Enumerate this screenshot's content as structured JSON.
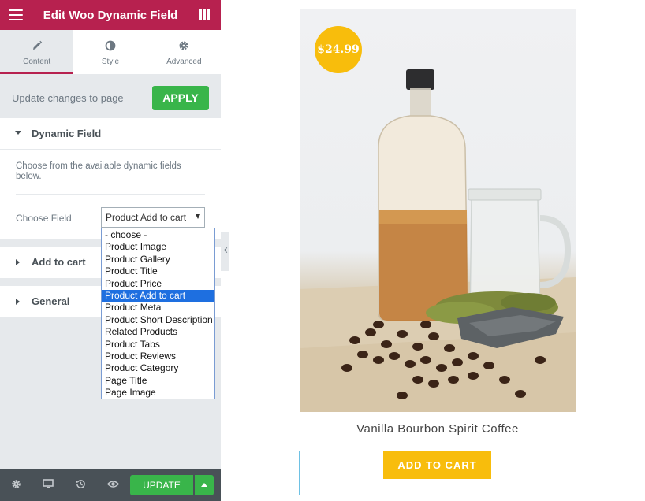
{
  "panel": {
    "title": "Edit Woo Dynamic Field",
    "tabs": [
      {
        "label": "Content",
        "icon": "pencil-icon"
      },
      {
        "label": "Style",
        "icon": "half-circle-icon"
      },
      {
        "label": "Advanced",
        "icon": "gear-icon"
      }
    ],
    "apply_row": {
      "text": "Update changes to page",
      "button": "APPLY"
    },
    "sections": {
      "dynamic_field": "Dynamic Field",
      "add_to_cart": "Add to cart",
      "general": "General"
    },
    "description": "Choose from the available dynamic fields below.",
    "choose_field": {
      "label": "Choose Field",
      "selected": "Product Add to cart",
      "options": [
        "- choose -",
        "Product Image",
        "Product Gallery",
        "Product Title",
        "Product Price",
        "Product Add to cart",
        "Product Meta",
        "Product Short Description",
        "Related Products",
        "Product Tabs",
        "Product Reviews",
        "Product Category",
        "Page Title",
        "Page Image"
      ]
    },
    "footer": {
      "update": "UPDATE"
    }
  },
  "preview": {
    "price": "$24.99",
    "product_title": "Vanilla Bourbon Spirit Coffee",
    "add_to_cart": "ADD TO CART"
  },
  "colors": {
    "brand": "#b7214f",
    "apply_green": "#39b54a",
    "price_yellow": "#f8bd0c",
    "selected_option": "#1e6fe0",
    "footer_dark": "#495157"
  }
}
